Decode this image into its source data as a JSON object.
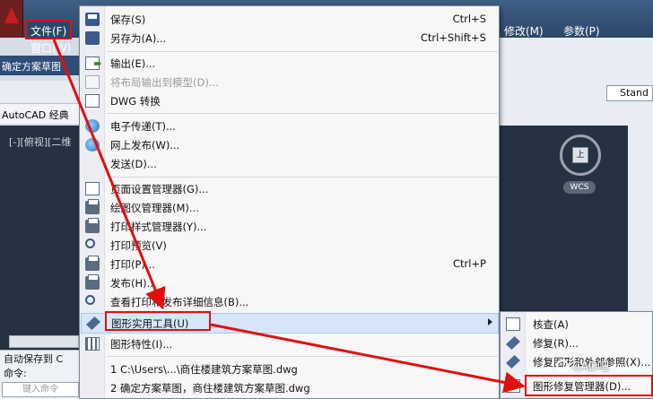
{
  "app": {
    "menubar": {
      "file": "文件(F)",
      "window": "窗口(W)",
      "modify": "修改(M)",
      "params": "参数(P)"
    },
    "doc_tab": "确定方案草图",
    "workspace": "AutoCAD 经典",
    "viewport_label": "[-][俯视][二维",
    "view_cube_face": "上",
    "wcs": "WCS",
    "style_box": "Stand",
    "command": {
      "line1": "自动保存到 C",
      "line2": "命令:",
      "input_placeholder": "键入命令"
    }
  },
  "file_menu": {
    "items": [
      {
        "label": "保存(S)",
        "shortcut": "Ctrl+S",
        "icon": "save-icon"
      },
      {
        "label": "另存为(A)...",
        "shortcut": "Ctrl+Shift+S",
        "icon": "save-as-icon"
      },
      {
        "label": "输出(E)...",
        "shortcut": "",
        "icon": "export-icon"
      },
      {
        "label": "将布局输出到模型(D)...",
        "shortcut": "",
        "icon": "layout-export-icon",
        "disabled": true
      },
      {
        "label": "DWG 转换",
        "shortcut": "",
        "icon": "dwg-convert-icon"
      },
      {
        "label": "电子传递(T)...",
        "shortcut": "",
        "icon": "etransmit-icon"
      },
      {
        "label": "网上发布(W)...",
        "shortcut": "",
        "icon": "publish-web-icon"
      },
      {
        "label": "发送(D)...",
        "shortcut": "",
        "icon": "send-icon"
      },
      {
        "label": "页面设置管理器(G)...",
        "shortcut": "",
        "icon": "page-setup-icon"
      },
      {
        "label": "绘图仪管理器(M)...",
        "shortcut": "",
        "icon": "plotter-manager-icon"
      },
      {
        "label": "打印样式管理器(Y)...",
        "shortcut": "",
        "icon": "plot-style-icon"
      },
      {
        "label": "打印预览(V)",
        "shortcut": "",
        "icon": "plot-preview-icon"
      },
      {
        "label": "打印(P)...",
        "shortcut": "Ctrl+P",
        "icon": "print-icon"
      },
      {
        "label": "发布(H)...",
        "shortcut": "",
        "icon": "publish-icon"
      },
      {
        "label": "查看打印和发布详细信息(B)...",
        "shortcut": "",
        "icon": "plot-details-icon"
      },
      {
        "label": "图形实用工具(U)",
        "shortcut": "",
        "icon": "drawing-utilities-icon",
        "submenu": true
      },
      {
        "label": "图形特性(I)...",
        "shortcut": "",
        "icon": "drawing-properties-icon"
      },
      {
        "label": "1 C:\\Users\\...\\商住楼建筑方案草图.dwg",
        "shortcut": "",
        "icon": ""
      },
      {
        "label": "2 确定方案草图，商住楼建筑方案草图.dwg",
        "shortcut": "",
        "icon": ""
      }
    ]
  },
  "submenu": {
    "items": [
      {
        "label": "核查(A)",
        "icon": "audit-icon"
      },
      {
        "label": "修复(R)...",
        "icon": "recover-icon"
      },
      {
        "label": "修复图形和外部参照(X)...",
        "icon": "recover-xref-icon"
      },
      {
        "label": "图形修复管理器(D)...",
        "icon": "recovery-manager-icon"
      }
    ]
  },
  "watermark": "CAD吧",
  "annotation_color": "#e01010"
}
